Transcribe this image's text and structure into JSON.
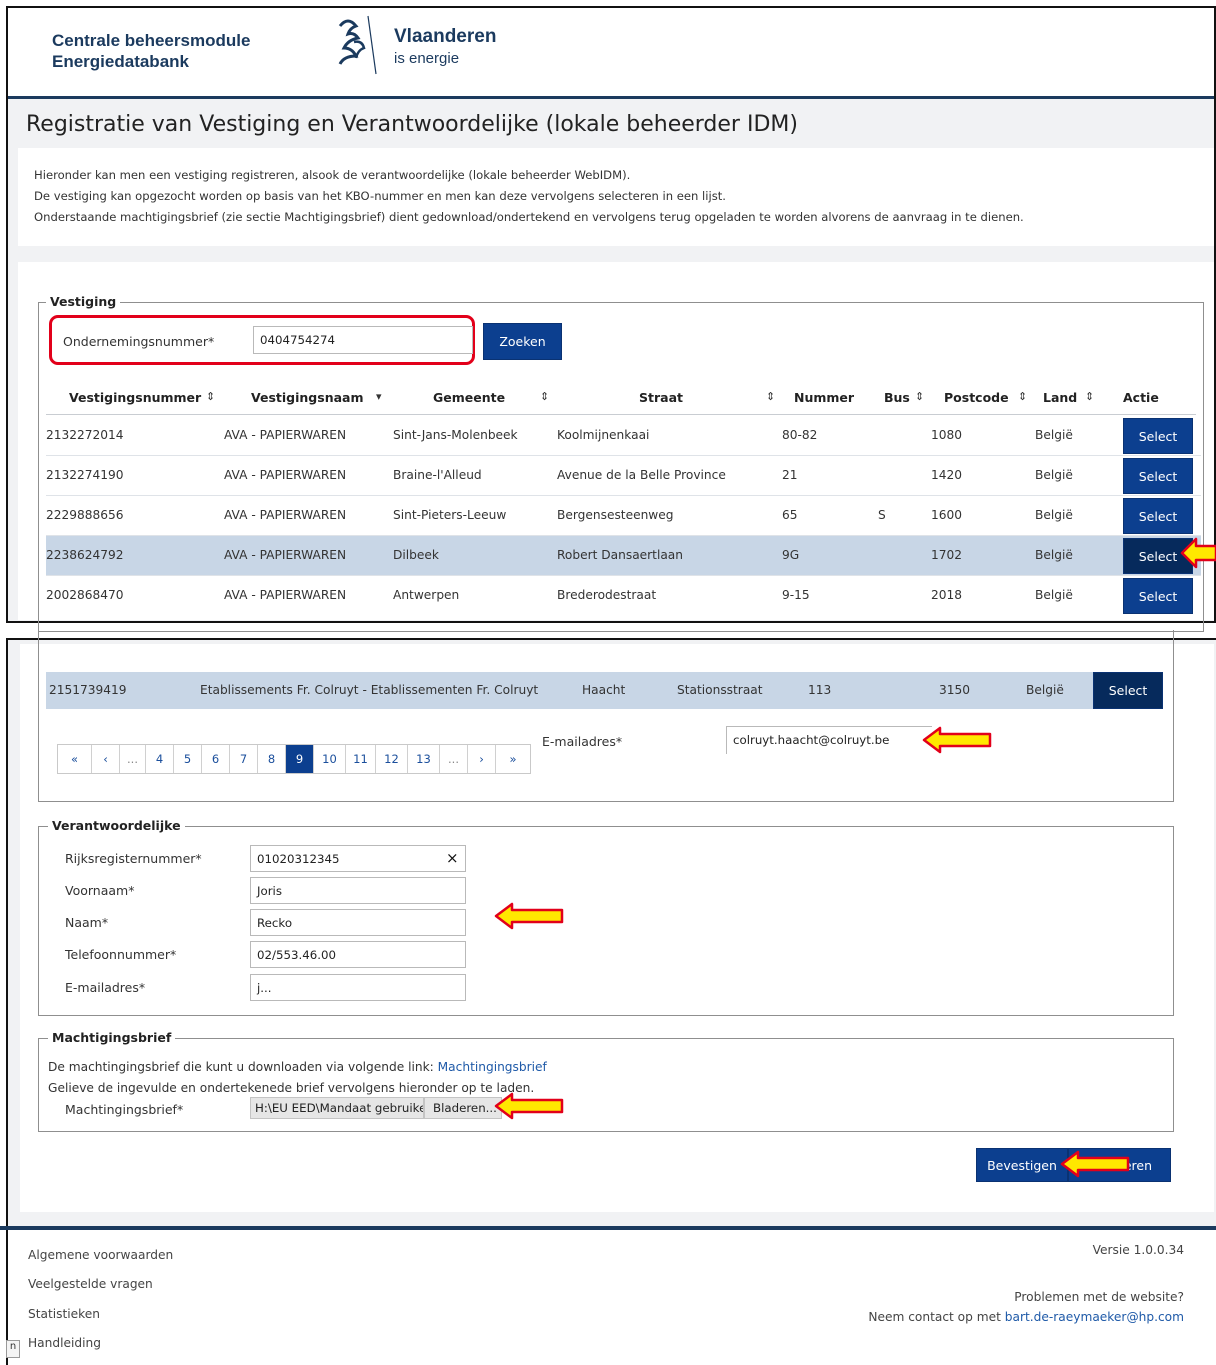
{
  "header": {
    "brand_line1": "Centrale beheersmodule",
    "brand_line2": "Energiedatabank",
    "logo_icon": "vlaanderen-lion-icon",
    "vl_title": "Vlaanderen",
    "vl_subtitle": "is energie"
  },
  "page_title": "Registratie van Vestiging en Verantwoordelijke (lokale beheerder IDM)",
  "intro": [
    "Hieronder kan men een vestiging registreren, alsook de verantwoordelijke (lokale beheerder WebIDM).",
    "De vestiging kan opgezocht worden op basis van het KBO-nummer en men kan deze vervolgens selecteren in een lijst.",
    "Onderstaande machtigingsbrief (zie sectie Machtigingsbrief) dient gedownload/ondertekend en vervolgens terug opgeladen te worden alvorens de aanvraag in te dienen."
  ],
  "vestiging": {
    "legend": "Vestiging",
    "search_label": "Ondernemingsnummer*",
    "search_value": "0404754274",
    "search_button": "Zoeken",
    "columns": [
      "Vestigingsnummer",
      "Vestigingsnaam",
      "Gemeente",
      "Straat",
      "Nummer",
      "Bus",
      "Postcode",
      "Land",
      "Actie"
    ],
    "sort_up_down": "⇕",
    "sort_down": "▾",
    "rows": [
      {
        "nr": "2132272014",
        "naam": "AVA - PAPIERWAREN",
        "gemeente": "Sint-Jans-Molenbeek",
        "straat": "Koolmijnenkaai",
        "nummer": "80-82",
        "bus": "",
        "postcode": "1080",
        "land": "België",
        "actie": "Select"
      },
      {
        "nr": "2132274190",
        "naam": "AVA - PAPIERWAREN",
        "gemeente": "Braine-l'Alleud",
        "straat": "Avenue de la Belle Province",
        "nummer": "21",
        "bus": "",
        "postcode": "1420",
        "land": "België",
        "actie": "Select"
      },
      {
        "nr": "2229888656",
        "naam": "AVA - PAPIERWAREN",
        "gemeente": "Sint-Pieters-Leeuw",
        "straat": "Bergensesteenweg",
        "nummer": "65",
        "bus": "S",
        "postcode": "1600",
        "land": "België",
        "actie": "Select"
      },
      {
        "nr": "2238624792",
        "naam": "AVA - PAPIERWAREN",
        "gemeente": "Dilbeek",
        "straat": "Robert Dansaertlaan",
        "nummer": "9G",
        "bus": "",
        "postcode": "1702",
        "land": "België",
        "actie": "Select"
      },
      {
        "nr": "2002868470",
        "naam": "AVA - PAPIERWAREN",
        "gemeente": "Antwerpen",
        "straat": "Brederodestraat",
        "nummer": "9-15",
        "bus": "",
        "postcode": "2018",
        "land": "België",
        "actie": "Select"
      }
    ]
  },
  "selected_row": {
    "nr": "2151739419",
    "naam": "Etablissements Fr. Colruyt - Etablissementen Fr. Colruyt",
    "gemeente": "Haacht",
    "straat": "Stationsstraat",
    "nummer": "113",
    "postcode": "3150",
    "land": "België",
    "actie": "Select"
  },
  "pager": [
    "«",
    "‹",
    "...",
    "4",
    "5",
    "6",
    "7",
    "8",
    "9",
    "10",
    "11",
    "12",
    "13",
    "...",
    "›",
    "»"
  ],
  "pager_active": "9",
  "vestiging_email": {
    "label": "E-mailadres*",
    "value": "colruyt.haacht@colruyt.be"
  },
  "verantwoordelijke": {
    "legend": "Verantwoordelijke",
    "fields": [
      {
        "label": "Rijksregisternummer*",
        "value": "01020312345"
      },
      {
        "label": "Voornaam*",
        "value": "Joris"
      },
      {
        "label": "Naam*",
        "value": "Recko"
      },
      {
        "label": "Telefoonnummer*",
        "value": "02/553.46.00"
      },
      {
        "label": "E-mailadres*",
        "value": "j..."
      }
    ],
    "clear_icon": "×"
  },
  "machtiging": {
    "legend": "Machtigingsbrief",
    "line1": "De machtingingsbrief die kunt u downloaden via volgende link:",
    "link": "Machtingingsbrief",
    "line2": "Gelieve de ingevulde en ondertekenede brief vervolgens hieronder op te laden.",
    "file_label": "Machtingingsbrief*",
    "file_value": "H:\\EU EED\\Mandaat gebruike",
    "browse_button": "Bladeren..."
  },
  "actions": {
    "confirm": "Bevestigen",
    "cancel_partial": "eren"
  },
  "footer": {
    "links": [
      "Algemene voorwaarden",
      "Veelgestelde vragen",
      "Statistieken",
      "Handleiding"
    ],
    "version": "Versie 1.0.0.34",
    "problems": "Problemen met de website?",
    "contact_prefix": "Neem contact op met",
    "contact_email": "bart.de-raeymaeker@hp.com",
    "corner_glyph": "n"
  },
  "colors": {
    "primary": "#0c3f8f",
    "selected_row": "#c8d6e6",
    "highlight_red": "#e2001a",
    "arrow_fill": "#ffe800",
    "arrow_outline": "#e2001a"
  }
}
